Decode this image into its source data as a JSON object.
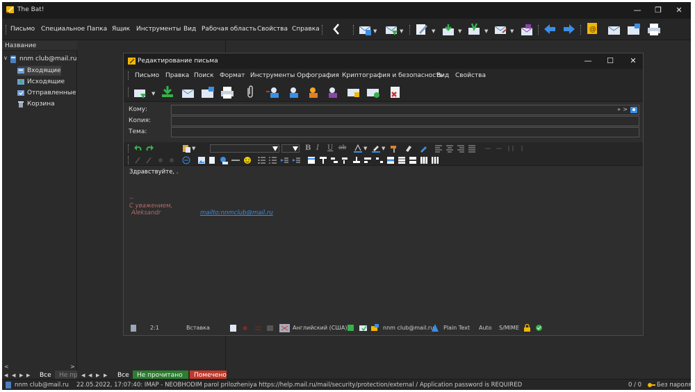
{
  "app": {
    "title": "The Bat!",
    "colors": {
      "background": "#2b2b2b",
      "titlebar": "#1b1b1b",
      "accent_blue": "#3a8ee6",
      "green": "#36b24a",
      "red_tab": "#c0392b",
      "green_tab": "#2e7d32"
    }
  },
  "menu": [
    "Письмо",
    "Специальное",
    "Папка",
    "Ящик",
    "Инструменты",
    "Вид",
    "Рабочая область",
    "Свойства",
    "Справка"
  ],
  "folders": {
    "header": "Название",
    "account": "nnm club@mail.ru",
    "items": [
      {
        "label": "Входящие",
        "icon": "inbox-icon"
      },
      {
        "label": "Исходящие",
        "icon": "outbox-icon"
      },
      {
        "label": "Отправленные",
        "icon": "sent-icon"
      },
      {
        "label": "Корзина",
        "icon": "trash-icon"
      }
    ]
  },
  "bottom_tabs_left": [
    "Все",
    "Не пр"
  ],
  "bottom_tabs_main": [
    "Все",
    "Не прочитано",
    "Помечено"
  ],
  "statusbar": {
    "account": "nnm club@mail.ru",
    "message": "22.05.2022, 17:07:40: IMAP  - NEOBHODIM parol prilozheniya https://help.mail.ru/mail/security/protection/external / Application password is REQUIRED",
    "counter": "0 / 0",
    "no_password": "Без пароля"
  },
  "editor": {
    "title": "Редактирование письма",
    "menu": [
      "Письмо",
      "Правка",
      "Поиск",
      "Формат",
      "Инструменты",
      "Орфография",
      "Криптография и безопасность",
      "Вид",
      "Свойства"
    ],
    "fields": {
      "to_label": "Кому:",
      "cc_label": "Копия:",
      "subject_label": "Тема:"
    },
    "body": {
      "greeting": "Здравствуйте, .",
      "separator": "--",
      "regards": "С уважением,",
      "name": "Aleksandr",
      "email_link": "mailto:nnmclub@mail.ru"
    },
    "status": {
      "position": "2:1",
      "mode": "Вставка",
      "language": "Английский (США)",
      "account": "nnm club@mail.ru",
      "format": "Plain Text",
      "auto": "Auto",
      "smime": "S/MIME"
    }
  }
}
